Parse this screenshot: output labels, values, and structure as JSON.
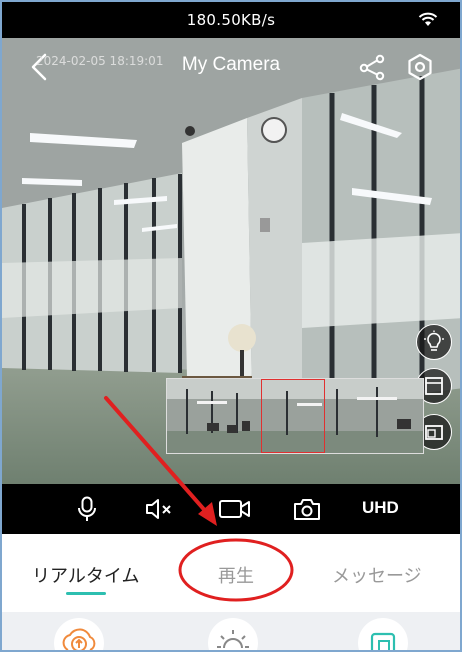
{
  "status_bar": {
    "network_speed": "180.50KB/s",
    "wifi_icon": "wifi-icon"
  },
  "header": {
    "timestamp": "2024-02-05 18:19:01",
    "title": "My Camera",
    "back_icon": "chevron-left-icon",
    "share_icon": "share-icon",
    "settings_icon": "gear-icon"
  },
  "side_controls": [
    "light-bulb-icon",
    "fullscreen-icon",
    "picture-in-picture-icon"
  ],
  "controls": {
    "mic_icon": "microphone-icon",
    "mute_icon": "speaker-mute-icon",
    "record_icon": "video-record-icon",
    "snapshot_icon": "camera-icon",
    "quality_label": "UHD"
  },
  "tabs": [
    {
      "label": "リアルタイム",
      "active": true
    },
    {
      "label": "再生",
      "active": false
    },
    {
      "label": "メッセージ",
      "active": false
    }
  ],
  "features": [
    "cloud-upload-icon",
    "brightness-icon",
    "window-icon"
  ],
  "colors": {
    "accent": "#2dbfb0",
    "annotation": "#e02020",
    "statusbar": "#000000"
  }
}
